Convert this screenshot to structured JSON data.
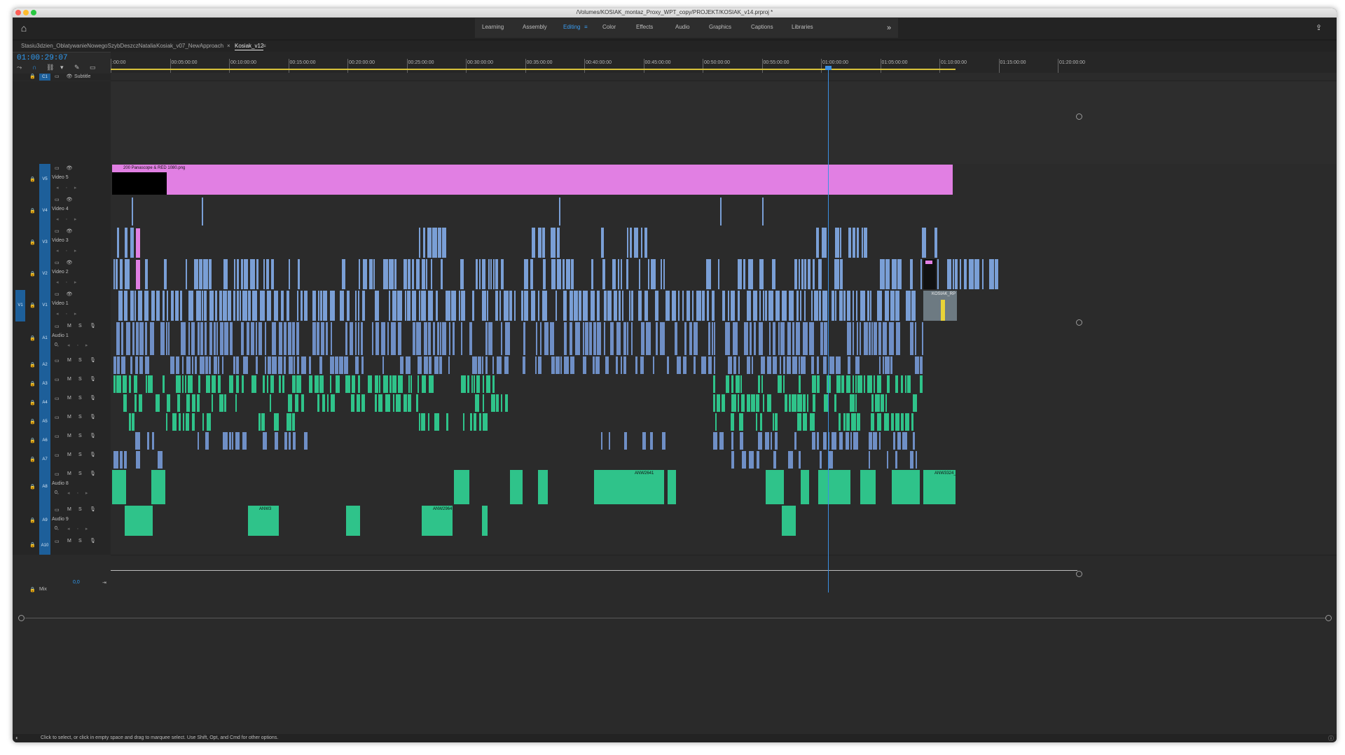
{
  "window": {
    "title": "/Volumes/KOSIAK_montaz_Proxy_WPT_copy/PROJEKT/KOSIAK_v14.prproj *",
    "traffic_lights": [
      "#fe5f57",
      "#febc2e",
      "#28c840"
    ]
  },
  "workspaces": {
    "items": [
      "Learning",
      "Assembly",
      "Editing",
      "Color",
      "Effects",
      "Audio",
      "Graphics",
      "Captions",
      "Libraries"
    ],
    "active": "Editing",
    "more": "»",
    "editing_menu_icon": "≡"
  },
  "sequence_tabs": [
    {
      "label": "Stasiu3dzien_OblatywanieNowegoSzybDeszczNatalia"
    },
    {
      "label": "Kosiak_v07_NewApproach"
    },
    {
      "label": "Kosiak_v12",
      "active": true,
      "close": "×",
      "menu": "≡"
    }
  ],
  "timecode": "01:00:29:07",
  "ruler": {
    "labels": [
      ":00:00",
      "00:05:00:00",
      "00:10:00:00",
      "00:15:00:00",
      "00:20:00:00",
      "00:25:00:00",
      "00:30:00:00",
      "00:35:00:00",
      "00:40:00:00",
      "00:45:00:00",
      "00:50:00:00",
      "00:55:00:00",
      "01:00:00:00",
      "01:05:00:00",
      "01:10:00:00",
      "01:15:00:00",
      "01:20:00:00"
    ]
  },
  "tracks": {
    "subtitle": {
      "target": "C1",
      "name": "Subtitle"
    },
    "video": [
      {
        "target": "V5",
        "name": "Video 5"
      },
      {
        "target": "V4",
        "name": "Video 4"
      },
      {
        "target": "V3",
        "name": "Video 3"
      },
      {
        "target": "V2",
        "name": "Video 2"
      },
      {
        "source": "V1",
        "target": "V1",
        "name": "Video 1"
      }
    ],
    "audio": [
      {
        "target": "A1",
        "name": "Audio 1",
        "volume": "0,"
      },
      {
        "target": "A2"
      },
      {
        "target": "A3"
      },
      {
        "target": "A4"
      },
      {
        "target": "A5"
      },
      {
        "target": "A6"
      },
      {
        "target": "A7"
      },
      {
        "target": "A8",
        "name": "Audio 8",
        "volume": "0,"
      },
      {
        "target": "A9",
        "name": "Audio 9",
        "volume": "0,"
      },
      {
        "target": "A10"
      }
    ],
    "mix": {
      "name": "Mix",
      "value": "0,0"
    },
    "audio_controls": {
      "m": "M",
      "s": "S"
    }
  },
  "clips": {
    "v5_pink": "200 Panascope & RED 1080.png",
    "v1_end": "KOSIAK_RP",
    "a8_a": "ANW2641",
    "a8_b": "ANW3324_",
    "a9_a": "ANW3",
    "a9_b": "ANW2964"
  },
  "status": {
    "text": "Click to select, or click in empty space and drag to marquee select. Use Shift, Opt, and Cmd for other options."
  },
  "colors": {
    "accent": "#2f9cf4",
    "video_clip": "#7a9fd6",
    "audio_clip": "#2fc38a",
    "graphic_clip": "#e17fe3"
  }
}
